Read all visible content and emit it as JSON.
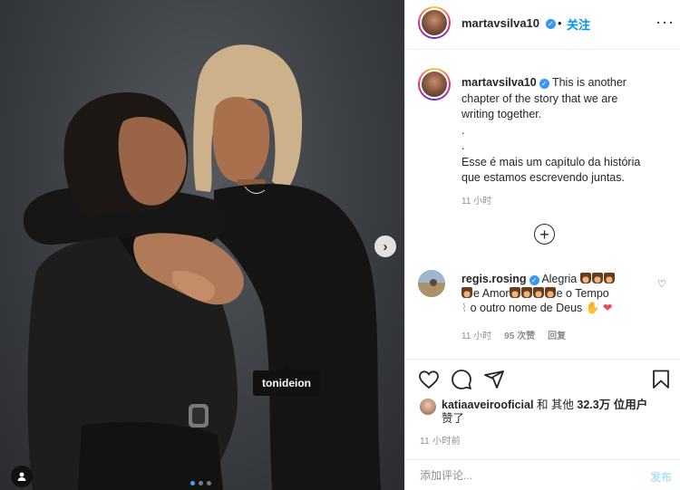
{
  "post": {
    "author": "martavsilva10",
    "separator": "•",
    "follow_label": "关注",
    "more_label": "···",
    "photo_tag": "tonideion",
    "caption": {
      "username": "martavsilva10",
      "lines": [
        "This is another",
        "chapter of the story that we are",
        "writing together.",
        ".",
        ".",
        "Esse é mais um capítulo da história",
        "que estamos escrevendo juntas."
      ],
      "time": "11 小时"
    },
    "comment": {
      "username": "regis.rosing",
      "text_1": "Alegria",
      "text_2": "e Amor",
      "text_3": "e o Tempo",
      "text_4": "o outro nome de Deus",
      "time": "11 小时",
      "likes": "95 次赞",
      "reply": "回复"
    },
    "likes": {
      "user": "katiaaveirooficial",
      "text_middle": "和 其他",
      "count": "32.3万",
      "text_end": "位用户",
      "text_line2": "赞了"
    },
    "posted_time": "11 小时前",
    "composer": {
      "placeholder": "添加评论...",
      "publish_label": "发布"
    },
    "colors": {
      "link_blue": "#0095f6",
      "verified_blue": "#3897f0",
      "muted_text": "#8e8e8e",
      "heart_red": "#ed4956"
    },
    "icons": [
      "next-arrow-icon",
      "user-tag-icon",
      "verified-icon",
      "more-icon",
      "plus-circle-icon",
      "heart-icon",
      "comment-icon",
      "share-icon",
      "bookmark-icon"
    ]
  }
}
